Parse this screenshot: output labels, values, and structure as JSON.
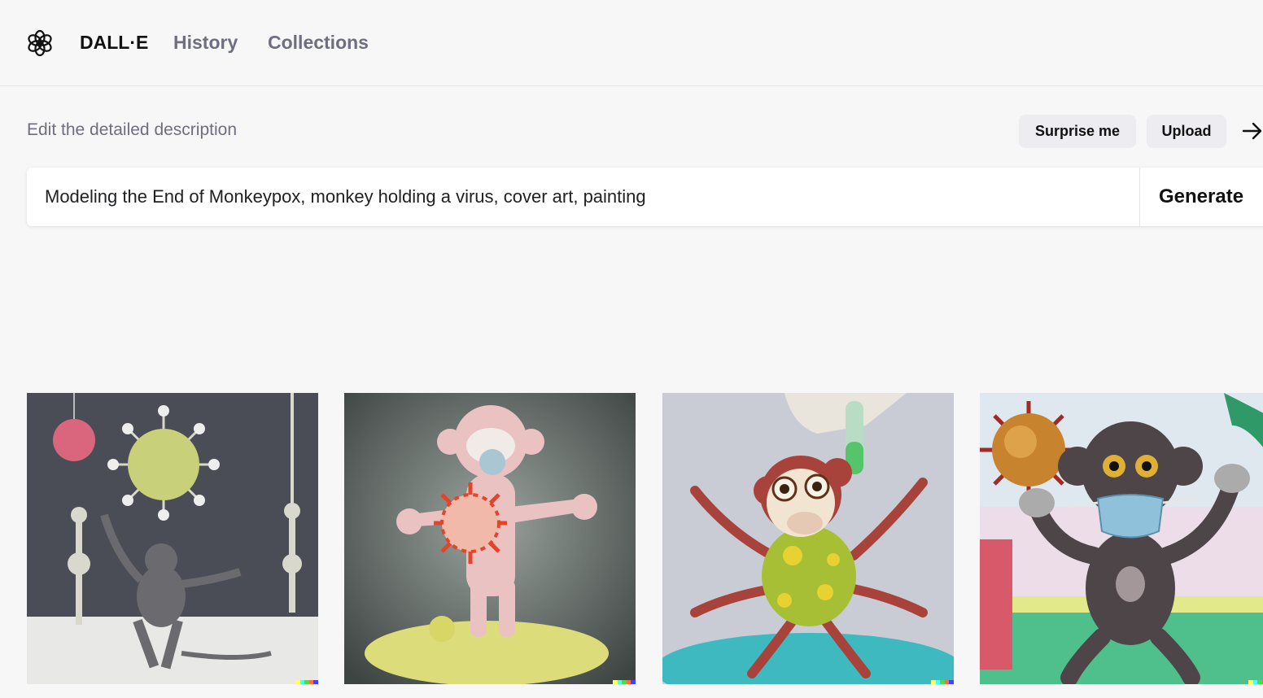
{
  "nav": {
    "brand": "DALL·E",
    "history": "History",
    "collections": "Collections"
  },
  "editor": {
    "label": "Edit the detailed description",
    "surprise": "Surprise me",
    "upload": "Upload",
    "prompt_value": "Modeling the End of Monkeypox, monkey holding a virus, cover art, painting",
    "generate": "Generate"
  },
  "results": {
    "images": [
      {
        "subject": "watercolor monkey dancing below a green virus"
      },
      {
        "subject": "clay monkey figure with red virus"
      },
      {
        "subject": "clay monkey with yellow-green body and test tube"
      },
      {
        "subject": "painted monkey in mask holding a virus"
      }
    ]
  },
  "colors": {
    "background": "#f7f7f8",
    "text": "#202123",
    "muted": "#6e6e80",
    "pill": "#ececf1",
    "signature": [
      "#ffff66",
      "#42ffff",
      "#51da4c",
      "#ff6e3c",
      "#3c46ff"
    ]
  },
  "icons": [
    "openai-logo-icon",
    "arrow-right-icon"
  ]
}
